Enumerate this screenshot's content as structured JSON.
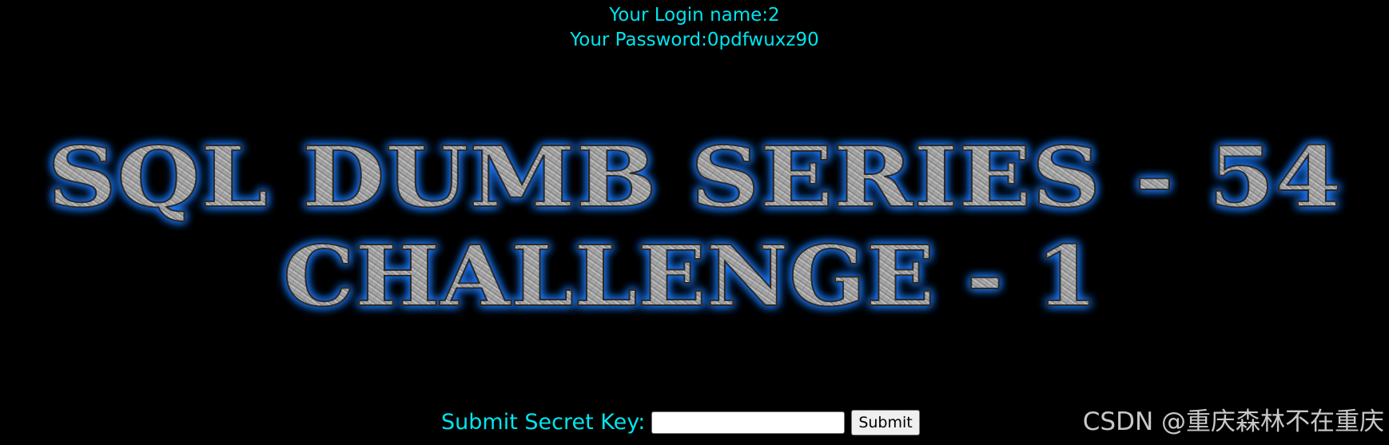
{
  "login_info": {
    "login_line": "Your Login name:2",
    "password_line": "Your Password:0pdfwuxz90"
  },
  "banner": {
    "line1": "SQL DUMB SERIES - 54",
    "line2": "CHALLENGE - 1"
  },
  "form": {
    "label": "Submit Secret Key:",
    "input_value": "",
    "submit_label": "Submit"
  },
  "watermark": "CSDN @重庆森林不在重庆",
  "colors": {
    "background": "#000000",
    "info_text": "#00e5ee",
    "banner_glow": "#1e7bff",
    "banner_metal": "#a8a8a8"
  }
}
